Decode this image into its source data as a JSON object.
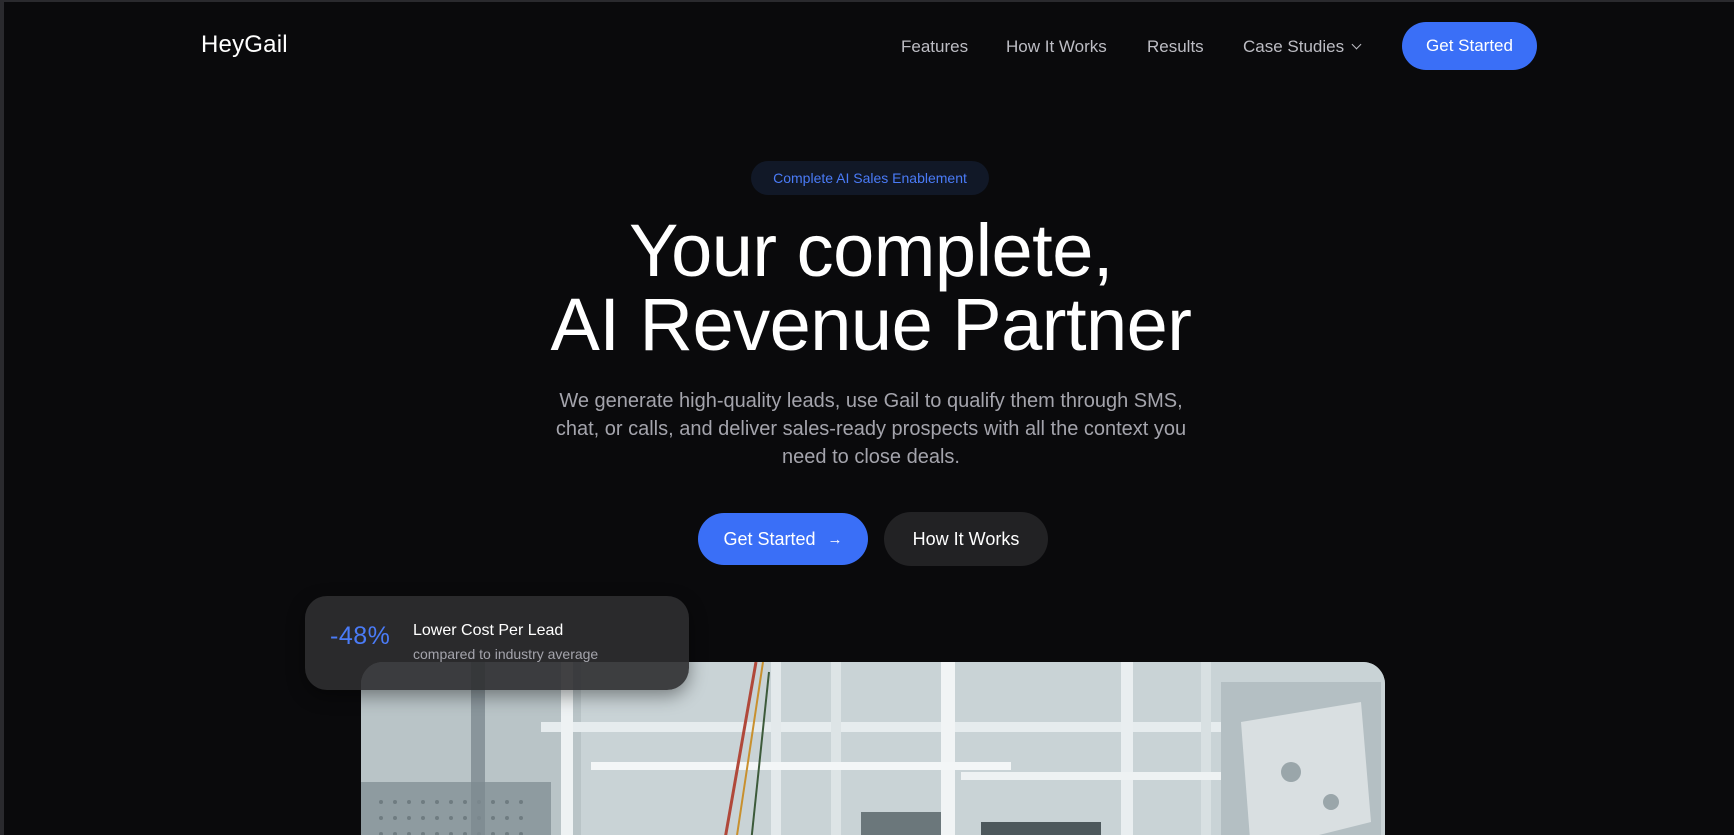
{
  "nav": {
    "logo": "HeyGail",
    "links": [
      {
        "label": "Features"
      },
      {
        "label": "How It Works"
      },
      {
        "label": "Results"
      },
      {
        "label": "Case Studies"
      }
    ],
    "cta_label": "Get Started"
  },
  "hero": {
    "badge": "Complete AI Sales Enablement",
    "headline_line1": "Your complete,",
    "headline_line2": "AI Revenue Partner",
    "subtext": "We generate high-quality leads, use Gail to qualify them through SMS, chat, or calls, and deliver sales-ready prospects with all the context you need to close deals.",
    "primary_button": "Get Started",
    "primary_button_icon": "arrow-right-icon",
    "secondary_button": "How It Works"
  },
  "stat_card": {
    "value": "-48%",
    "title": "Lower Cost Per Lead",
    "subtitle": "compared to industry average"
  },
  "colors": {
    "background": "#0a0a0c",
    "accent": "#3a6ff7",
    "muted_text": "#a4a4ac",
    "secondary_button": "#222224"
  }
}
